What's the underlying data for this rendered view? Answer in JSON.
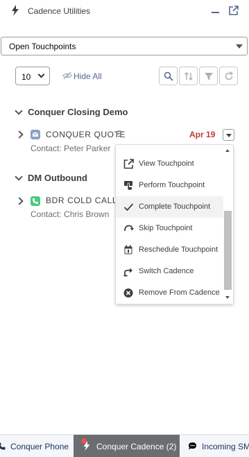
{
  "header": {
    "title": "Cadence Utilities"
  },
  "filter": {
    "selected": "Open Touchpoints"
  },
  "toolbar": {
    "page_size": "10",
    "hide_all_label": "Hide All"
  },
  "groups": [
    {
      "name": "Conquer Closing Demo",
      "touchpoints": [
        {
          "name": "CONQUER QUOTE",
          "contact": "Contact: Peter Parker",
          "due": "Apr 19",
          "icon": "email-icon",
          "icon_color": "#8a9fc4"
        }
      ]
    },
    {
      "name": "DM Outbound",
      "touchpoints": [
        {
          "name": "BDR COLD CALL -",
          "contact": "Contact: Chris Brown",
          "icon": "phone-icon",
          "icon_color": "#4bca81"
        }
      ]
    }
  ],
  "menu": {
    "items": [
      {
        "label": "View Touchpoint",
        "icon": "external-link-icon"
      },
      {
        "label": "Perform Touchpoint",
        "icon": "touch-icon"
      },
      {
        "label": "Complete Touchpoint",
        "icon": "check-icon"
      },
      {
        "label": "Skip Touchpoint",
        "icon": "skip-icon"
      },
      {
        "label": "Reschedule Touchpoint",
        "icon": "calendar-icon"
      },
      {
        "label": "Switch Cadence",
        "icon": "switch-icon"
      },
      {
        "label": "Remove From Cadence",
        "icon": "remove-icon"
      }
    ],
    "active_index": 2
  },
  "footer": {
    "tabs": [
      {
        "label": "Conquer Phone",
        "icon": "phone-icon"
      },
      {
        "label": "Conquer Cadence (2)",
        "icon": "bolt-icon",
        "active": true
      },
      {
        "label": "Incoming SMS",
        "icon": "chat-icon"
      }
    ]
  },
  "colors": {
    "due_overdue": "#c23934",
    "active_tab_bg": "#6b6d70",
    "notification_dot": "#e8554e",
    "text_link": "#16325c"
  }
}
